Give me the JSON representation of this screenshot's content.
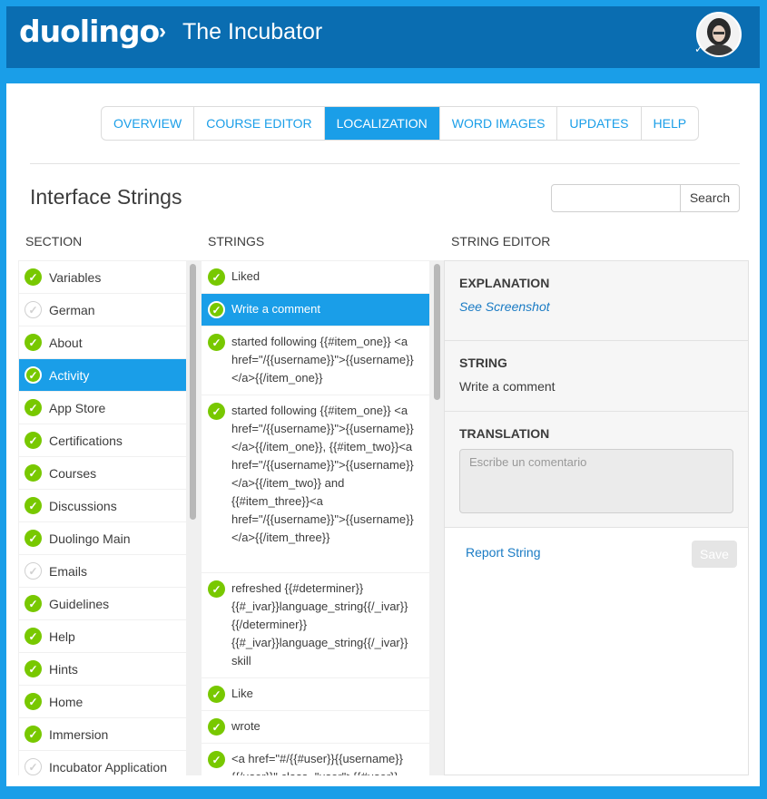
{
  "header": {
    "logo": "duolingo",
    "breadcrumb_sep": "›",
    "breadcrumb": "The Incubator"
  },
  "tabs": [
    {
      "label": "OVERVIEW",
      "active": false
    },
    {
      "label": "COURSE EDITOR",
      "active": false
    },
    {
      "label": "LOCALIZATION",
      "active": true
    },
    {
      "label": "WORD IMAGES",
      "active": false
    },
    {
      "label": "UPDATES",
      "active": false
    },
    {
      "label": "HELP",
      "active": false
    }
  ],
  "page": {
    "title": "Interface Strings",
    "search_button": "Search",
    "search_value": ""
  },
  "columns": {
    "section": "SECTION",
    "strings": "STRINGS",
    "editor": "STRING EDITOR"
  },
  "sections": [
    {
      "label": "Variables",
      "done": true
    },
    {
      "label": "German",
      "done": false
    },
    {
      "label": "About",
      "done": true
    },
    {
      "label": "Activity",
      "done": true,
      "active": true
    },
    {
      "label": "App Store",
      "done": true
    },
    {
      "label": "Certifications",
      "done": true
    },
    {
      "label": "Courses",
      "done": true
    },
    {
      "label": "Discussions",
      "done": true
    },
    {
      "label": "Duolingo Main",
      "done": true
    },
    {
      "label": "Emails",
      "done": false
    },
    {
      "label": "Guidelines",
      "done": true
    },
    {
      "label": "Help",
      "done": true
    },
    {
      "label": "Hints",
      "done": true
    },
    {
      "label": "Home",
      "done": true
    },
    {
      "label": "Immersion",
      "done": true
    },
    {
      "label": "Incubator Application",
      "done": false
    }
  ],
  "strings": [
    {
      "text": "Liked",
      "active": false
    },
    {
      "text": "Write a comment",
      "active": true
    },
    {
      "text": "started following {{#item_one}} <a href=\"/{{username}}\">{{username}}</a>{{/item_one}}",
      "active": false
    },
    {
      "text": "started following {{#item_one}} <a href=\"/{{username}}\">{{username}}</a>{{/item_one}}, {{#item_two}}<a href=\"/{{username}}\">{{username}}</a>{{/item_two}} and {{#item_three}}<a href=\"/{{username}}\">{{username}}</a>{{/item_three}}",
      "active": false
    },
    {
      "text": "refreshed {{#determiner}}{{#_ivar}}language_string{{/_ivar}}{{/determiner}} {{#_ivar}}language_string{{/_ivar}} skill",
      "active": false
    },
    {
      "text": "Like",
      "active": false
    },
    {
      "text": "wrote",
      "active": false
    },
    {
      "text": "<a href=\"#/{{#user}}{{username}}{{/user}}\" class=\"user\">{{#user}}",
      "active": false
    }
  ],
  "editor": {
    "explanation_label": "EXPLANATION",
    "screenshot_link": "See Screenshot",
    "string_label": "STRING",
    "string_value": "Write a comment",
    "translation_label": "TRANSLATION",
    "translation_placeholder": "Escribe un comentario",
    "report_link": "Report String",
    "save_button": "Save"
  },
  "colors": {
    "brand_blue": "#1a9ee8",
    "header_blue": "#0a6db1",
    "check_green": "#78c800"
  }
}
